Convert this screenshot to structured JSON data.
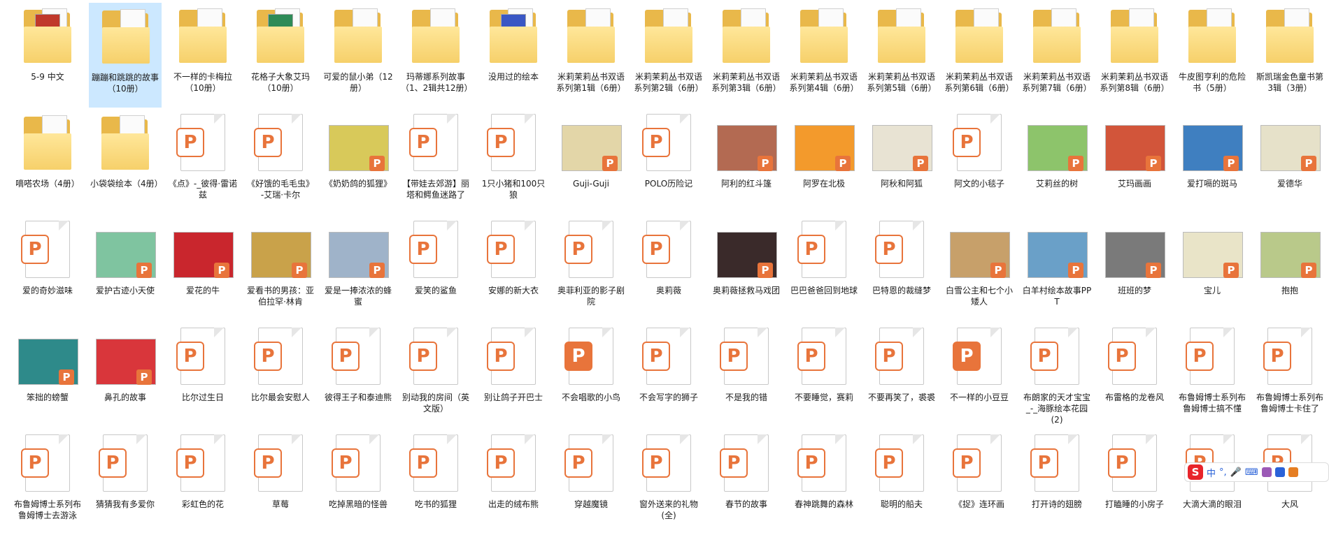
{
  "colors": {
    "selection": "#cce8ff",
    "ppt_orange": "#e8743b",
    "folder": "#e9b84a",
    "ime_red": "#e8242a"
  },
  "items": [
    {
      "type": "folder",
      "label": "5-9 中文",
      "cover": "#c0392b"
    },
    {
      "type": "folder",
      "label": "蹦蹦和跳跳的故事（10册）",
      "selected": true
    },
    {
      "type": "folder",
      "label": "不一样的卡梅拉（10册）"
    },
    {
      "type": "folder",
      "label": "花格子大象艾玛（10册）",
      "cover": "#2e8b57"
    },
    {
      "type": "folder",
      "label": "可爱的鼠小弟（12册）"
    },
    {
      "type": "folder",
      "label": "玛蒂娜系列故事（1、2辑共12册）"
    },
    {
      "type": "folder",
      "label": "没用过的绘本",
      "cover": "#3a57c4"
    },
    {
      "type": "folder",
      "label": "米莉茉莉丛书双语系列第1辑（6册）"
    },
    {
      "type": "folder",
      "label": "米莉茉莉丛书双语系列第2辑（6册）"
    },
    {
      "type": "folder",
      "label": "米莉茉莉丛书双语系列第3辑（6册）"
    },
    {
      "type": "folder",
      "label": "米莉茉莉丛书双语系列第4辑（6册）"
    },
    {
      "type": "folder",
      "label": "米莉茉莉丛书双语系列第5辑（6册）"
    },
    {
      "type": "folder",
      "label": "米莉茉莉丛书双语系列第6辑（6册）"
    },
    {
      "type": "folder",
      "label": "米莉茉莉丛书双语系列第7辑（6册）"
    },
    {
      "type": "folder",
      "label": "米莉茉莉丛书双语系列第8辑（6册）"
    },
    {
      "type": "folder",
      "label": "牛皮图亨利的危险书（5册）"
    },
    {
      "type": "folder",
      "label": "斯凯瑞金色童书第3辑（3册）"
    },
    {
      "type": "folder",
      "label": "嘀嗒农场（4册）"
    },
    {
      "type": "folder",
      "label": "小袋袋绘本（4册）"
    },
    {
      "type": "ppt",
      "label": "《点》-_彼得·雷诺兹"
    },
    {
      "type": "ppt",
      "label": "《好饿的毛毛虫》-艾瑞·卡尔"
    },
    {
      "type": "thumb",
      "label": "《奶奶鸽的狐狸》",
      "thumb": "#d8c95a"
    },
    {
      "type": "ppt",
      "label": "【带娃去郊游】丽塔和鳄鱼迷路了"
    },
    {
      "type": "ppt",
      "label": "1只小猪和100只狼"
    },
    {
      "type": "thumb",
      "label": "Guji-Guji",
      "thumb": "#e3d6a8"
    },
    {
      "type": "ppt",
      "label": "POLO历险记"
    },
    {
      "type": "thumb",
      "label": "阿利的红斗篷",
      "thumb": "#b36a52"
    },
    {
      "type": "thumb",
      "label": "阿罗在北极",
      "thumb": "#f39a2c"
    },
    {
      "type": "thumb",
      "label": "阿秋和阿狐",
      "thumb": "#e8e3d3"
    },
    {
      "type": "ppt",
      "label": "阿文的小毯子"
    },
    {
      "type": "thumb",
      "label": "艾莉丝的树",
      "thumb": "#8dc46b"
    },
    {
      "type": "thumb",
      "label": "艾玛画画",
      "thumb": "#d2553a"
    },
    {
      "type": "thumb",
      "label": "爱打嗝的斑马",
      "thumb": "#3f7fc0"
    },
    {
      "type": "thumb",
      "label": "爱德华",
      "thumb": "#e6e1c9"
    },
    {
      "type": "ppt",
      "label": "爱的奇妙滋味"
    },
    {
      "type": "thumb",
      "label": "爱护古迹小天使",
      "thumb": "#7fc4a0"
    },
    {
      "type": "thumb",
      "label": "爱花的牛",
      "thumb": "#c9262d"
    },
    {
      "type": "thumb",
      "label": "爱看书的男孩：亚伯拉罕·林肯",
      "thumb": "#c9a24a"
    },
    {
      "type": "thumb",
      "label": "爱是一捧浓浓的蜂蜜",
      "thumb": "#9fb3c9"
    },
    {
      "type": "ppt",
      "label": "爱笑的鲨鱼"
    },
    {
      "type": "ppt",
      "label": "安娜的新大衣"
    },
    {
      "type": "ppt",
      "label": "奥菲利亚的影子剧院"
    },
    {
      "type": "ppt",
      "label": "奥莉薇"
    },
    {
      "type": "thumb",
      "label": "奥莉薇拯救马戏团",
      "thumb": "#3a2a2a"
    },
    {
      "type": "ppt",
      "label": "巴巴爸爸回到地球"
    },
    {
      "type": "ppt",
      "label": "巴特恩的裁缝梦"
    },
    {
      "type": "thumb",
      "label": "白雪公主和七个小矮人",
      "thumb": "#c7a06a"
    },
    {
      "type": "thumb",
      "label": "白羊村绘本故事PPT",
      "thumb": "#6aa0c8"
    },
    {
      "type": "thumb",
      "label": "班班的梦",
      "thumb": "#7a7a7a"
    },
    {
      "type": "thumb",
      "label": "宝儿",
      "thumb": "#e9e4c8"
    },
    {
      "type": "thumb",
      "label": "抱抱",
      "thumb": "#b9c98a"
    },
    {
      "type": "thumb",
      "label": "笨拙的螃蟹",
      "thumb": "#2e8a8a"
    },
    {
      "type": "thumb",
      "label": "鼻孔的故事",
      "thumb": "#d9363b"
    },
    {
      "type": "ppt",
      "label": "比尔过生日"
    },
    {
      "type": "ppt",
      "label": "比尔最会安慰人"
    },
    {
      "type": "ppt",
      "label": "彼得王子和泰迪熊"
    },
    {
      "type": "ppt",
      "label": "别动我的房间（英文版）"
    },
    {
      "type": "ppt",
      "label": "别让鸽子开巴士"
    },
    {
      "type": "ppt",
      "label": "不会唱歌的小鸟",
      "solid": true
    },
    {
      "type": "ppt",
      "label": "不会写字的狮子"
    },
    {
      "type": "ppt",
      "label": "不是我的错"
    },
    {
      "type": "ppt",
      "label": "不要睡觉，赛莉"
    },
    {
      "type": "ppt",
      "label": "不要再笑了，裘裘"
    },
    {
      "type": "ppt",
      "label": "不一样的小豆豆",
      "solid": true
    },
    {
      "type": "ppt",
      "label": "布朗家的天才宝宝_-_海豚绘本花园(2)"
    },
    {
      "type": "ppt",
      "label": "布雷格的龙卷风"
    },
    {
      "type": "ppt",
      "label": "布鲁姆博士系列布鲁姆博士搞不懂"
    },
    {
      "type": "ppt",
      "label": "布鲁姆博士系列布鲁姆博士卡住了"
    },
    {
      "type": "ppt",
      "label": "布鲁姆博士系列布鲁姆博士去游泳"
    },
    {
      "type": "ppt",
      "label": "猜猜我有多爱你"
    },
    {
      "type": "ppt",
      "label": "彩虹色的花"
    },
    {
      "type": "ppt",
      "label": "草莓"
    },
    {
      "type": "ppt",
      "label": "吃掉黑暗的怪兽"
    },
    {
      "type": "ppt",
      "label": "吃书的狐狸"
    },
    {
      "type": "ppt",
      "label": "出走的绒布熊"
    },
    {
      "type": "ppt",
      "label": "穿越魔镜"
    },
    {
      "type": "ppt",
      "label": "窗外送来的礼物(全)"
    },
    {
      "type": "ppt",
      "label": "春节的故事"
    },
    {
      "type": "ppt",
      "label": "春神跳舞的森林"
    },
    {
      "type": "ppt",
      "label": "聪明的船夫"
    },
    {
      "type": "ppt",
      "label": "《捉》连环画"
    },
    {
      "type": "ppt",
      "label": "打开诗的翅膀"
    },
    {
      "type": "ppt",
      "label": "打瞌睡的小房子"
    },
    {
      "type": "ppt",
      "label": "大滴大滴的眼泪"
    },
    {
      "type": "ppt",
      "label": "大风"
    }
  ],
  "ime": {
    "logo": "S",
    "lang": "中",
    "punct": "°,"
  }
}
